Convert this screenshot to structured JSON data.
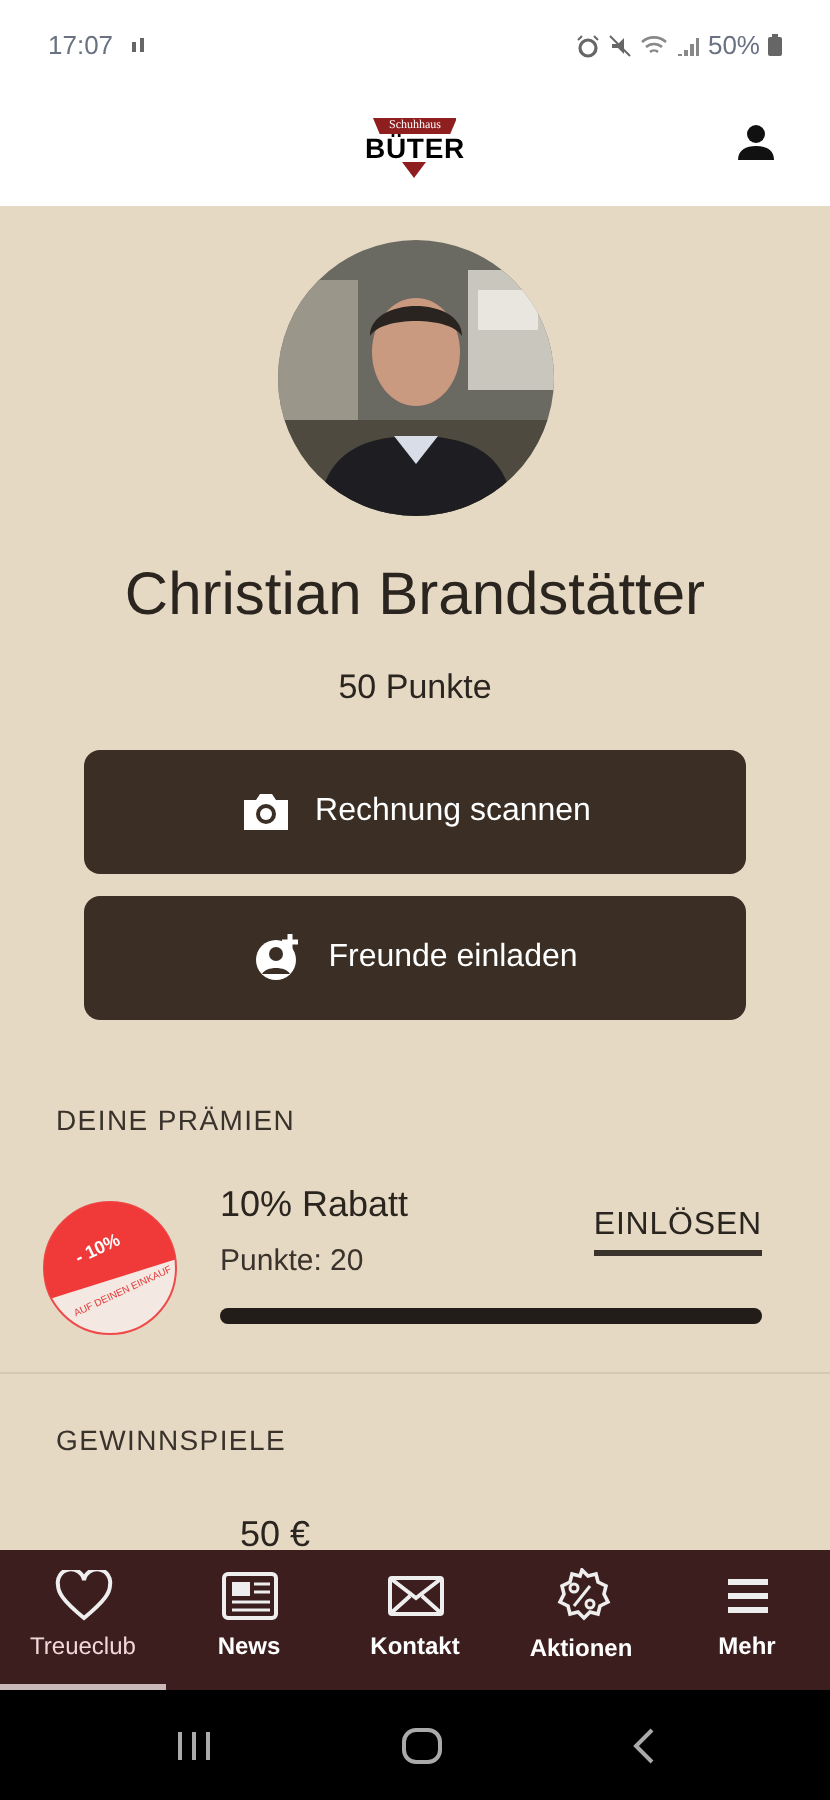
{
  "status_bar": {
    "time": "17:07",
    "battery": "50%"
  },
  "header": {
    "logo_top": "Schuhhaus",
    "logo_main": "BÜTER"
  },
  "profile": {
    "name": "Christian Brandstätter",
    "points": "50 Punkte"
  },
  "actions": [
    {
      "kind": "camera",
      "label": "Rechnung scannen"
    },
    {
      "kind": "invite",
      "label": "Freunde einladen"
    }
  ],
  "rewards": {
    "title": "DEINE PRÄMIEN",
    "items": [
      {
        "badge_top": "- 10%",
        "badge_bottom": "AUF DEINEN EINKAUF",
        "title": "10% Rabatt",
        "points": "Punkte: 20",
        "action": "EINLÖSEN",
        "level": 1
      }
    ]
  },
  "contests": {
    "title": "GEWINNSPIELE",
    "items": [
      {
        "amount": "50 €"
      }
    ]
  },
  "bottom_nav": [
    {
      "kind": "heart",
      "label": "Treueclub",
      "selected": true
    },
    {
      "kind": "news",
      "label": "News",
      "selected": false
    },
    {
      "kind": "mail",
      "label": "Kontakt",
      "selected": false
    },
    {
      "kind": "percent",
      "label": "Aktionen",
      "selected": false
    },
    {
      "kind": "menu",
      "label": "Mehr",
      "selected": false
    }
  ]
}
